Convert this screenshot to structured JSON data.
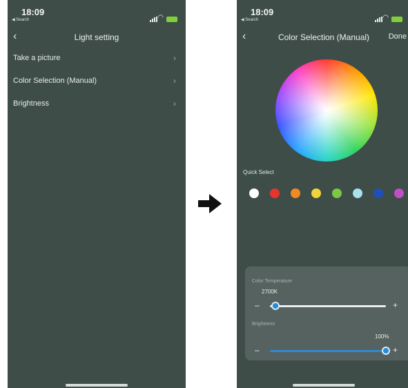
{
  "left_screen": {
    "status": {
      "time": "18:09",
      "back_app": "◀ Search"
    },
    "nav": {
      "title": "Light setting"
    },
    "menu": [
      {
        "label": "Take a picture"
      },
      {
        "label": "Color Selection (Manual)"
      },
      {
        "label": "Brightness"
      }
    ]
  },
  "right_screen": {
    "status": {
      "time": "18:09",
      "back_app": "◀ Search"
    },
    "nav": {
      "title": "Color Selection (Manual)",
      "done": "Done"
    },
    "quick_select": {
      "label": "Quick Select",
      "colors": [
        "#ffffff",
        "#e8332e",
        "#f08a24",
        "#f0d43a",
        "#7ac943",
        "#a9e1ec",
        "#1f4fb8",
        "#c04fc4"
      ]
    },
    "panel": {
      "color_temperature_label": "Color Temperature",
      "color_temperature_value": "2700K",
      "color_temperature_level": 0.05,
      "brightness_label": "Brightness",
      "brightness_value": "100%",
      "brightness_level": 1.0,
      "minus": "–",
      "plus": "+"
    }
  },
  "icons": {
    "back": "chevron-left-icon",
    "chevron": "chevron-right-icon",
    "flow_arrow": "right-arrow-icon"
  },
  "colors": {
    "screen_bg": "#3f4d49",
    "panel_bg": "#56625f",
    "accent": "#2a8ad6",
    "battery": "#7fd13b"
  }
}
